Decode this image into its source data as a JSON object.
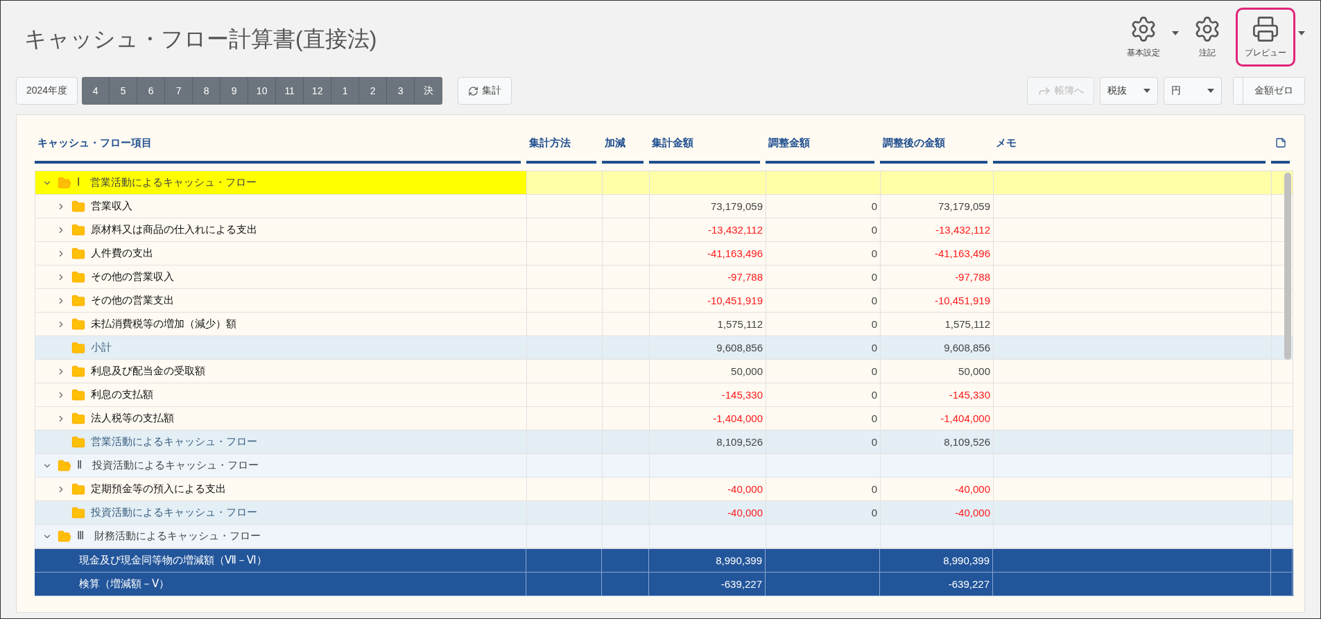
{
  "title": "キャッシュ・フロー計算書(直接法)",
  "top_actions": [
    {
      "kind": "settings",
      "label": "基本設定",
      "dropdown": true,
      "highlighted": false
    },
    {
      "kind": "settings",
      "label": "注記",
      "dropdown": false,
      "highlighted": false
    },
    {
      "kind": "print",
      "label": "プレビュー",
      "dropdown": true,
      "highlighted": true
    }
  ],
  "toolbar": {
    "year": "2024年度",
    "months": [
      {
        "label": "4",
        "selected": false
      },
      {
        "label": "5",
        "selected": false
      },
      {
        "label": "6",
        "selected": false
      },
      {
        "label": "7",
        "selected": false
      },
      {
        "label": "8",
        "selected": false
      },
      {
        "label": "9",
        "selected": false
      },
      {
        "label": "10",
        "selected": false
      },
      {
        "label": "11",
        "selected": false
      },
      {
        "label": "12",
        "selected": false
      },
      {
        "label": "1",
        "selected": false
      },
      {
        "label": "2",
        "selected": false
      },
      {
        "label": "3",
        "selected": false
      },
      {
        "label": "決",
        "selected": false
      }
    ],
    "aggregate": "集計",
    "ledger": {
      "label": "帳簿へ",
      "disabled": true
    },
    "tax_select": "税抜",
    "unit_select": "円",
    "zero_amount": "金額ゼロ",
    "zero_toggle_checked": false
  },
  "table": {
    "columns": [
      "キャッシュ・フロー項目",
      "集計方法",
      "加減",
      "集計金額",
      "調整金額",
      "調整後の金額",
      "メモ"
    ],
    "rows": [
      {
        "kind": "section",
        "label": "Ⅰ　営業活動によるキャッシュ・フロー",
        "expanded": true,
        "selected": true
      },
      {
        "kind": "item",
        "label": "営業収入",
        "expanded": false,
        "selected": false,
        "total": "73,179,059",
        "adjustment": "0",
        "adjusted": "73,179,059",
        "negative": false
      },
      {
        "kind": "item",
        "label": "原材料又は商品の仕入れによる支出",
        "expanded": false,
        "selected": false,
        "total": "-13,432,112",
        "adjustment": "0",
        "adjusted": "-13,432,112",
        "negative": true
      },
      {
        "kind": "item",
        "label": "人件費の支出",
        "expanded": false,
        "selected": false,
        "total": "-41,163,496",
        "adjustment": "0",
        "adjusted": "-41,163,496",
        "negative": true
      },
      {
        "kind": "item",
        "label": "その他の営業収入",
        "expanded": false,
        "selected": false,
        "total": "-97,788",
        "adjustment": "0",
        "adjusted": "-97,788",
        "negative": true
      },
      {
        "kind": "item",
        "label": "その他の営業支出",
        "expanded": false,
        "selected": false,
        "total": "-10,451,919",
        "adjustment": "0",
        "adjusted": "-10,451,919",
        "negative": true
      },
      {
        "kind": "item",
        "label": "未払消費税等の増加（減少）額",
        "expanded": false,
        "selected": false,
        "total": "1,575,112",
        "adjustment": "0",
        "adjusted": "1,575,112",
        "negative": false
      },
      {
        "kind": "subtotal",
        "label": "小計",
        "selected": false,
        "total": "9,608,856",
        "adjustment": "0",
        "adjusted": "9,608,856",
        "negative": false
      },
      {
        "kind": "item",
        "label": "利息及び配当金の受取額",
        "expanded": false,
        "selected": false,
        "total": "50,000",
        "adjustment": "0",
        "adjusted": "50,000",
        "negative": false
      },
      {
        "kind": "item",
        "label": "利息の支払額",
        "expanded": false,
        "selected": false,
        "total": "-145,330",
        "adjustment": "0",
        "adjusted": "-145,330",
        "negative": true
      },
      {
        "kind": "item",
        "label": "法人税等の支払額",
        "expanded": false,
        "selected": false,
        "total": "-1,404,000",
        "adjustment": "0",
        "adjusted": "-1,404,000",
        "negative": true
      },
      {
        "kind": "subtotal",
        "label": "営業活動によるキャッシュ・フロー",
        "selected": false,
        "total": "8,109,526",
        "adjustment": "0",
        "adjusted": "8,109,526",
        "negative": false
      },
      {
        "kind": "section",
        "label": "Ⅱ　投資活動によるキャッシュ・フロー",
        "expanded": true,
        "selected": false
      },
      {
        "kind": "item",
        "label": "定期預金等の預入による支出",
        "expanded": false,
        "selected": false,
        "total": "-40,000",
        "adjustment": "0",
        "adjusted": "-40,000",
        "negative": true
      },
      {
        "kind": "subtotal",
        "label": "投資活動によるキャッシュ・フロー",
        "selected": false,
        "total": "-40,000",
        "adjustment": "0",
        "adjusted": "-40,000",
        "negative": true
      },
      {
        "kind": "section",
        "label": "Ⅲ　財務活動によるキャッシュ・フロー",
        "expanded": true,
        "selected": false
      }
    ],
    "footer_rows": [
      {
        "label": "現金及び現金同等物の増減額（Ⅶ－Ⅵ）",
        "total": "8,990,399",
        "adjusted": "8,990,399"
      },
      {
        "label": "検算（増減額－Ⅴ）",
        "total": "-639,227",
        "adjusted": "-639,227"
      }
    ]
  }
}
